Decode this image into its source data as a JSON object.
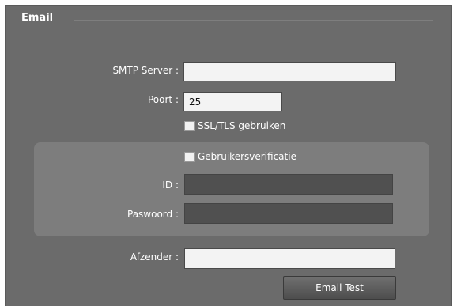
{
  "section": {
    "title": "Email"
  },
  "smtp": {
    "label": "SMTP Server :",
    "value": ""
  },
  "port": {
    "label": "Poort :",
    "value": "25"
  },
  "ssl": {
    "label": "SSL/TLS gebruiken",
    "checked": false
  },
  "auth": {
    "label": "Gebruikersverificatie",
    "checked": false,
    "id_label": "ID :",
    "id_value": "",
    "password_label": "Paswoord :",
    "password_value": ""
  },
  "sender": {
    "label": "Afzender :",
    "value": ""
  },
  "test_button": {
    "label": "Email Test"
  }
}
